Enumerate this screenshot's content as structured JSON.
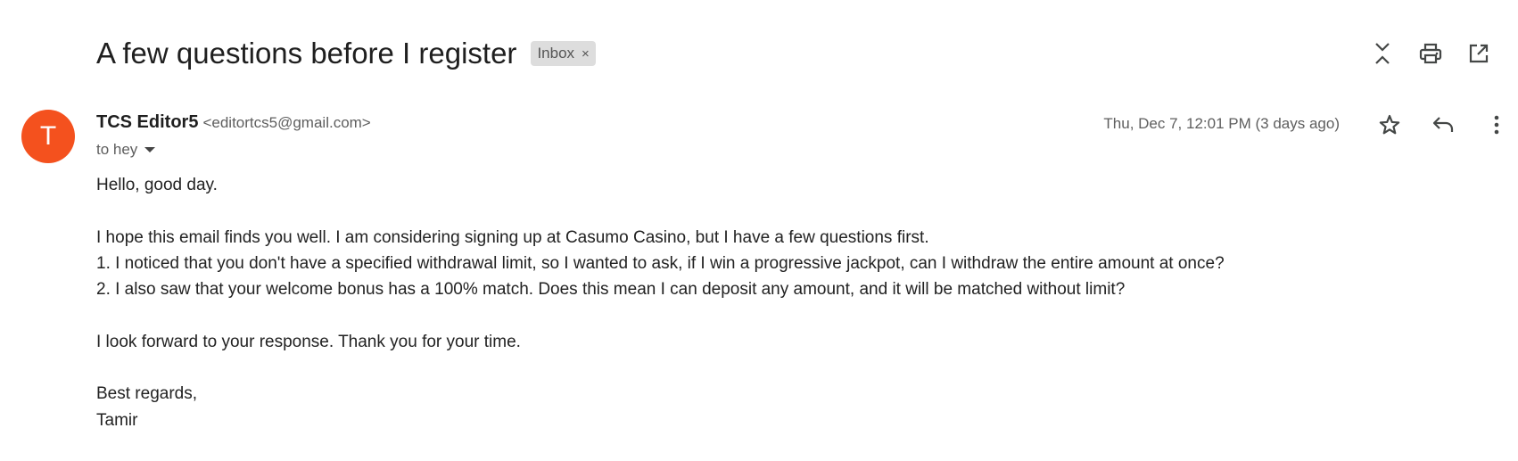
{
  "email": {
    "subject": "A few questions before I register",
    "label": "Inbox",
    "label_remove": "×",
    "sender": {
      "initial": "T",
      "avatar_color": "#f4511e",
      "name": "TCS Editor5",
      "email": "<editortcs5@gmail.com>"
    },
    "to": "to hey",
    "date": "Thu, Dec 7, 12:01 PM (3 days ago)",
    "body": {
      "greeting": "Hello, good day.",
      "line1": "I hope this email finds you well. I am considering signing up at Casumo Casino, but I have a few questions first.",
      "line2": "1. I noticed that you don't have a specified withdrawal limit, so I wanted to ask, if I win a progressive jackpot, can I withdraw the entire amount at once?",
      "line3": "2. I also saw that your welcome bonus has a 100% match. Does this mean I can deposit any amount, and it will be matched without limit?",
      "closing": "I look forward to your response. Thank you for your time.",
      "signoff": "Best regards,",
      "signature": "Tamir"
    }
  },
  "icons": {
    "collapse": "collapse-all-icon",
    "print": "print-icon",
    "new_window": "open-in-new-window-icon",
    "star": "star-icon",
    "reply": "reply-icon",
    "more": "more-vert-icon",
    "dropdown": "chevron-down-icon"
  },
  "colors": {
    "text": "#1f1f1f",
    "secondary_text": "#5e5e5e",
    "chip_bg": "#dddddd",
    "icon": "#444746"
  }
}
